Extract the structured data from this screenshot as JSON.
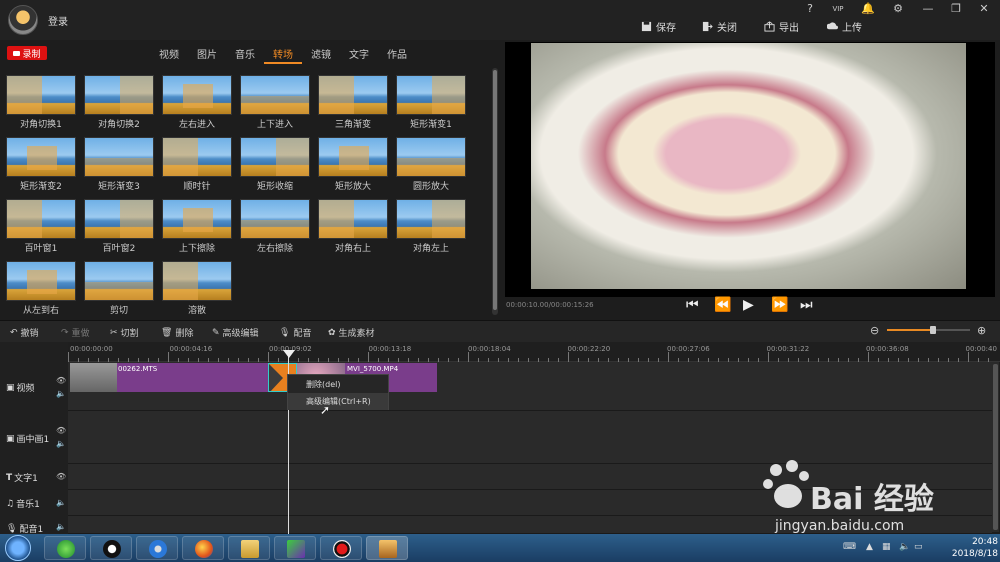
{
  "app": {
    "login_label": "登录",
    "window_buttons": [
      "?",
      "VIP",
      "🔔",
      "⚙",
      "—",
      "❐",
      "✕"
    ],
    "top_actions": [
      {
        "label": "保存",
        "icon": "save-icon"
      },
      {
        "label": "关闭",
        "icon": "close-project-icon"
      },
      {
        "label": "导出",
        "icon": "export-icon"
      },
      {
        "label": "上传",
        "icon": "upload-icon"
      }
    ]
  },
  "left_pane": {
    "record_label": "录制",
    "tabs": [
      {
        "label": "视频",
        "active": false
      },
      {
        "label": "图片",
        "active": false
      },
      {
        "label": "音乐",
        "active": false
      },
      {
        "label": "转场",
        "active": true
      },
      {
        "label": "滤镜",
        "active": false
      },
      {
        "label": "文字",
        "active": false
      },
      {
        "label": "作品",
        "active": false
      }
    ],
    "transitions": [
      "对角切换1",
      "对角切换2",
      "左右进入",
      "上下进入",
      "三角渐变",
      "矩形渐变1",
      "矩形渐变2",
      "矩形渐变3",
      "顺时针",
      "矩形收缩",
      "矩形放大",
      "圆形放大",
      "百叶窗1",
      "百叶窗2",
      "上下擦除",
      "左右擦除",
      "对角右上",
      "对角左上",
      "从左到右",
      "剪切",
      "溶散"
    ]
  },
  "preview": {
    "time": "00:00:10.00/00:00:15:26",
    "controls": [
      "skip-start-icon",
      "prev-frame-icon",
      "play-icon",
      "next-frame-icon",
      "skip-end-icon"
    ]
  },
  "toolbar": {
    "items": [
      {
        "label": "撤销",
        "icon": "undo-icon"
      },
      {
        "label": "重做",
        "icon": "redo-icon"
      },
      {
        "label": "切割",
        "icon": "scissors-icon"
      },
      {
        "label": "删除",
        "icon": "trash-icon"
      },
      {
        "label": "高级编辑",
        "icon": "pen-icon"
      },
      {
        "label": "配音",
        "icon": "mic-icon"
      },
      {
        "label": "生成素材",
        "icon": "film-reel-icon"
      }
    ],
    "zoom_level": 0.55
  },
  "timeline": {
    "ruler": [
      "00:00:00:00",
      "00:00:04:16",
      "00:00:09:02",
      "00:00:13:18",
      "00:00:18:04",
      "00:00:22:20",
      "00:00:27:06",
      "00:00:31:22",
      "00:00:36:08",
      "00:00:40"
    ],
    "tracks": [
      {
        "label": "视频"
      },
      {
        "label": "画中画1"
      },
      {
        "label": "文字1"
      },
      {
        "label": "音乐1"
      },
      {
        "label": "配音1"
      }
    ],
    "clips": [
      "00262.MTS",
      "MVI_5700.MP4"
    ],
    "context_menu": [
      {
        "label": "删除(del)"
      },
      {
        "label": "高级编辑(Ctrl+R)"
      }
    ]
  },
  "taskbar": {
    "time": "20:48",
    "date": "2018/8/18"
  },
  "watermark": {
    "text": "Bai  经验",
    "url": "jingyan.baidu.com"
  }
}
